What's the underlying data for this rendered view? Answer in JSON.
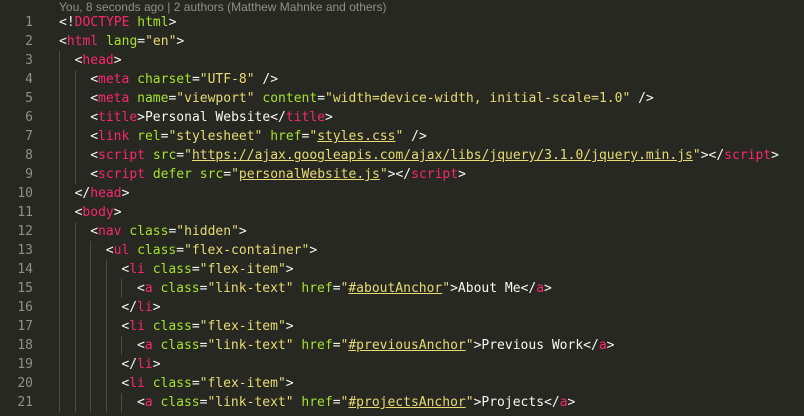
{
  "codelens": "You, 8 seconds ago | 2 authors (Matthew Mahnke and others)",
  "lines": [
    {
      "n": "1",
      "indent": 0,
      "tokens": [
        {
          "t": "<!",
          "c": "punc"
        },
        {
          "t": "DOCTYPE",
          "c": "tag"
        },
        {
          "t": " ",
          "c": "text"
        },
        {
          "t": "html",
          "c": "attr"
        },
        {
          "t": ">",
          "c": "punc"
        }
      ]
    },
    {
      "n": "2",
      "indent": 0,
      "tokens": [
        {
          "t": "<",
          "c": "punc"
        },
        {
          "t": "html",
          "c": "tag"
        },
        {
          "t": " ",
          "c": "text"
        },
        {
          "t": "lang",
          "c": "attr"
        },
        {
          "t": "=",
          "c": "punc"
        },
        {
          "t": "\"en\"",
          "c": "str"
        },
        {
          "t": ">",
          "c": "punc"
        }
      ]
    },
    {
      "n": "3",
      "indent": 1,
      "tokens": [
        {
          "t": "<",
          "c": "punc"
        },
        {
          "t": "head",
          "c": "tag"
        },
        {
          "t": ">",
          "c": "punc"
        }
      ]
    },
    {
      "n": "4",
      "indent": 2,
      "tokens": [
        {
          "t": "<",
          "c": "punc"
        },
        {
          "t": "meta",
          "c": "tag"
        },
        {
          "t": " ",
          "c": "text"
        },
        {
          "t": "charset",
          "c": "attr"
        },
        {
          "t": "=",
          "c": "punc"
        },
        {
          "t": "\"UTF-8\"",
          "c": "str"
        },
        {
          "t": " />",
          "c": "punc"
        }
      ]
    },
    {
      "n": "5",
      "indent": 2,
      "tokens": [
        {
          "t": "<",
          "c": "punc"
        },
        {
          "t": "meta",
          "c": "tag"
        },
        {
          "t": " ",
          "c": "text"
        },
        {
          "t": "name",
          "c": "attr"
        },
        {
          "t": "=",
          "c": "punc"
        },
        {
          "t": "\"viewport\"",
          "c": "str"
        },
        {
          "t": " ",
          "c": "text"
        },
        {
          "t": "content",
          "c": "attr"
        },
        {
          "t": "=",
          "c": "punc"
        },
        {
          "t": "\"width=device-width, initial-scale=1.0\"",
          "c": "str"
        },
        {
          "t": " />",
          "c": "punc"
        }
      ]
    },
    {
      "n": "6",
      "indent": 2,
      "tokens": [
        {
          "t": "<",
          "c": "punc"
        },
        {
          "t": "title",
          "c": "tag"
        },
        {
          "t": ">",
          "c": "punc"
        },
        {
          "t": "Personal Website",
          "c": "text"
        },
        {
          "t": "</",
          "c": "punc"
        },
        {
          "t": "title",
          "c": "tag"
        },
        {
          "t": ">",
          "c": "punc"
        }
      ]
    },
    {
      "n": "7",
      "indent": 2,
      "tokens": [
        {
          "t": "<",
          "c": "punc"
        },
        {
          "t": "link",
          "c": "tag"
        },
        {
          "t": " ",
          "c": "text"
        },
        {
          "t": "rel",
          "c": "attr"
        },
        {
          "t": "=",
          "c": "punc"
        },
        {
          "t": "\"stylesheet\"",
          "c": "str"
        },
        {
          "t": " ",
          "c": "text"
        },
        {
          "t": "href",
          "c": "attr"
        },
        {
          "t": "=",
          "c": "punc"
        },
        {
          "t": "\"",
          "c": "str"
        },
        {
          "t": "styles.css",
          "c": "str link"
        },
        {
          "t": "\"",
          "c": "str"
        },
        {
          "t": " />",
          "c": "punc"
        }
      ]
    },
    {
      "n": "8",
      "indent": 2,
      "tokens": [
        {
          "t": "<",
          "c": "punc"
        },
        {
          "t": "script",
          "c": "tag"
        },
        {
          "t": " ",
          "c": "text"
        },
        {
          "t": "src",
          "c": "attr"
        },
        {
          "t": "=",
          "c": "punc"
        },
        {
          "t": "\"",
          "c": "str"
        },
        {
          "t": "https://ajax.googleapis.com/ajax/libs/jquery/3.1.0/jquery.min.js",
          "c": "str link"
        },
        {
          "t": "\"",
          "c": "str"
        },
        {
          "t": "></",
          "c": "punc"
        },
        {
          "t": "script",
          "c": "tag"
        },
        {
          "t": ">",
          "c": "punc"
        }
      ]
    },
    {
      "n": "9",
      "indent": 2,
      "tokens": [
        {
          "t": "<",
          "c": "punc"
        },
        {
          "t": "script",
          "c": "tag"
        },
        {
          "t": " ",
          "c": "text"
        },
        {
          "t": "defer",
          "c": "attr"
        },
        {
          "t": " ",
          "c": "text"
        },
        {
          "t": "src",
          "c": "attr"
        },
        {
          "t": "=",
          "c": "punc"
        },
        {
          "t": "\"",
          "c": "str"
        },
        {
          "t": "personalWebsite.js",
          "c": "str link"
        },
        {
          "t": "\"",
          "c": "str"
        },
        {
          "t": "></",
          "c": "punc"
        },
        {
          "t": "script",
          "c": "tag"
        },
        {
          "t": ">",
          "c": "punc"
        }
      ]
    },
    {
      "n": "10",
      "indent": 1,
      "tokens": [
        {
          "t": "</",
          "c": "punc"
        },
        {
          "t": "head",
          "c": "tag"
        },
        {
          "t": ">",
          "c": "punc"
        }
      ]
    },
    {
      "n": "11",
      "indent": 1,
      "tokens": [
        {
          "t": "<",
          "c": "punc"
        },
        {
          "t": "body",
          "c": "tag"
        },
        {
          "t": ">",
          "c": "punc"
        }
      ]
    },
    {
      "n": "12",
      "indent": 2,
      "tokens": [
        {
          "t": "<",
          "c": "punc"
        },
        {
          "t": "nav",
          "c": "tag"
        },
        {
          "t": " ",
          "c": "text"
        },
        {
          "t": "class",
          "c": "attr"
        },
        {
          "t": "=",
          "c": "punc"
        },
        {
          "t": "\"hidden\"",
          "c": "str"
        },
        {
          "t": ">",
          "c": "punc"
        }
      ]
    },
    {
      "n": "13",
      "indent": 3,
      "tokens": [
        {
          "t": "<",
          "c": "punc"
        },
        {
          "t": "ul",
          "c": "tag"
        },
        {
          "t": " ",
          "c": "text"
        },
        {
          "t": "class",
          "c": "attr"
        },
        {
          "t": "=",
          "c": "punc"
        },
        {
          "t": "\"flex-container\"",
          "c": "str"
        },
        {
          "t": ">",
          "c": "punc"
        }
      ]
    },
    {
      "n": "14",
      "indent": 4,
      "tokens": [
        {
          "t": "<",
          "c": "punc"
        },
        {
          "t": "li",
          "c": "tag"
        },
        {
          "t": " ",
          "c": "text"
        },
        {
          "t": "class",
          "c": "attr"
        },
        {
          "t": "=",
          "c": "punc"
        },
        {
          "t": "\"flex-item\"",
          "c": "str"
        },
        {
          "t": ">",
          "c": "punc"
        }
      ]
    },
    {
      "n": "15",
      "indent": 5,
      "tokens": [
        {
          "t": "<",
          "c": "punc"
        },
        {
          "t": "a",
          "c": "tag"
        },
        {
          "t": " ",
          "c": "text"
        },
        {
          "t": "class",
          "c": "attr"
        },
        {
          "t": "=",
          "c": "punc"
        },
        {
          "t": "\"link-text\"",
          "c": "str"
        },
        {
          "t": " ",
          "c": "text"
        },
        {
          "t": "href",
          "c": "attr"
        },
        {
          "t": "=",
          "c": "punc"
        },
        {
          "t": "\"",
          "c": "str"
        },
        {
          "t": "#aboutAnchor",
          "c": "str link"
        },
        {
          "t": "\"",
          "c": "str"
        },
        {
          "t": ">",
          "c": "punc"
        },
        {
          "t": "About Me",
          "c": "text"
        },
        {
          "t": "</",
          "c": "punc"
        },
        {
          "t": "a",
          "c": "tag"
        },
        {
          "t": ">",
          "c": "punc"
        }
      ]
    },
    {
      "n": "16",
      "indent": 4,
      "tokens": [
        {
          "t": "</",
          "c": "punc"
        },
        {
          "t": "li",
          "c": "tag"
        },
        {
          "t": ">",
          "c": "punc"
        }
      ]
    },
    {
      "n": "17",
      "indent": 4,
      "tokens": [
        {
          "t": "<",
          "c": "punc"
        },
        {
          "t": "li",
          "c": "tag"
        },
        {
          "t": " ",
          "c": "text"
        },
        {
          "t": "class",
          "c": "attr"
        },
        {
          "t": "=",
          "c": "punc"
        },
        {
          "t": "\"flex-item\"",
          "c": "str"
        },
        {
          "t": ">",
          "c": "punc"
        }
      ]
    },
    {
      "n": "18",
      "indent": 5,
      "tokens": [
        {
          "t": "<",
          "c": "punc"
        },
        {
          "t": "a",
          "c": "tag"
        },
        {
          "t": " ",
          "c": "text"
        },
        {
          "t": "class",
          "c": "attr"
        },
        {
          "t": "=",
          "c": "punc"
        },
        {
          "t": "\"link-text\"",
          "c": "str"
        },
        {
          "t": " ",
          "c": "text"
        },
        {
          "t": "href",
          "c": "attr"
        },
        {
          "t": "=",
          "c": "punc"
        },
        {
          "t": "\"",
          "c": "str"
        },
        {
          "t": "#previousAnchor",
          "c": "str link"
        },
        {
          "t": "\"",
          "c": "str"
        },
        {
          "t": ">",
          "c": "punc"
        },
        {
          "t": "Previous Work",
          "c": "text"
        },
        {
          "t": "</",
          "c": "punc"
        },
        {
          "t": "a",
          "c": "tag"
        },
        {
          "t": ">",
          "c": "punc"
        }
      ]
    },
    {
      "n": "19",
      "indent": 4,
      "tokens": [
        {
          "t": "</",
          "c": "punc"
        },
        {
          "t": "li",
          "c": "tag"
        },
        {
          "t": ">",
          "c": "punc"
        }
      ]
    },
    {
      "n": "20",
      "indent": 4,
      "tokens": [
        {
          "t": "<",
          "c": "punc"
        },
        {
          "t": "li",
          "c": "tag"
        },
        {
          "t": " ",
          "c": "text"
        },
        {
          "t": "class",
          "c": "attr"
        },
        {
          "t": "=",
          "c": "punc"
        },
        {
          "t": "\"flex-item\"",
          "c": "str"
        },
        {
          "t": ">",
          "c": "punc"
        }
      ]
    },
    {
      "n": "21",
      "indent": 5,
      "tokens": [
        {
          "t": "<",
          "c": "punc"
        },
        {
          "t": "a",
          "c": "tag"
        },
        {
          "t": " ",
          "c": "text"
        },
        {
          "t": "class",
          "c": "attr"
        },
        {
          "t": "=",
          "c": "punc"
        },
        {
          "t": "\"link-text\"",
          "c": "str"
        },
        {
          "t": " ",
          "c": "text"
        },
        {
          "t": "href",
          "c": "attr"
        },
        {
          "t": "=",
          "c": "punc"
        },
        {
          "t": "\"",
          "c": "str"
        },
        {
          "t": "#projectsAnchor",
          "c": "str link"
        },
        {
          "t": "\"",
          "c": "str"
        },
        {
          "t": ">",
          "c": "punc"
        },
        {
          "t": "Projects",
          "c": "text"
        },
        {
          "t": "</",
          "c": "punc"
        },
        {
          "t": "a",
          "c": "tag"
        },
        {
          "t": ">",
          "c": "punc"
        }
      ]
    }
  ]
}
